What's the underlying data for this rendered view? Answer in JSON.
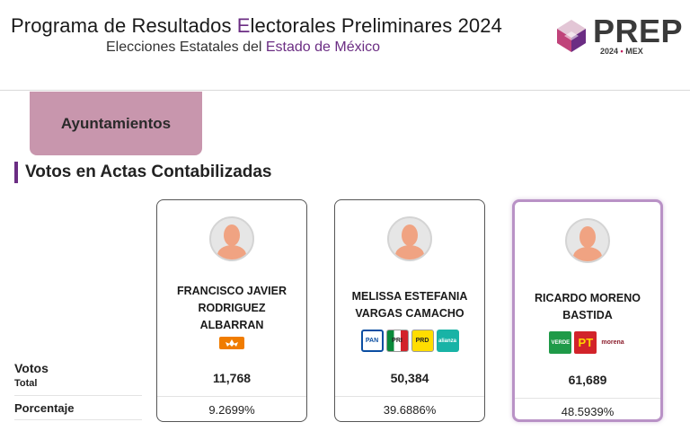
{
  "header": {
    "title_parts": [
      "Programa de Resultados ",
      "E",
      "lectorales Preliminares 2024"
    ],
    "subtitle_parts": [
      "Elecciones Estatales del ",
      "Estado de México"
    ],
    "logo_word": "PREP",
    "logo_year": "2024",
    "logo_dot": "•",
    "logo_state": "MEX"
  },
  "tabs": {
    "active_label": "Ayuntamientos"
  },
  "section": {
    "title": "Votos en Actas Contabilizadas"
  },
  "rows": {
    "votos_label": "Votos",
    "total_label": "Total",
    "porcentaje_label": "Porcentaje"
  },
  "candidates": [
    {
      "name_lines": [
        "FRANCISCO JAVIER",
        "RODRIGUEZ",
        "ALBARRAN"
      ],
      "parties": [
        "Movimiento Ciudadano"
      ],
      "party_short": [
        "MC"
      ],
      "votes": "11,768",
      "percentage": "9.2699%"
    },
    {
      "name_lines": [
        "MELISSA ESTEFANIA",
        "VARGAS CAMACHO"
      ],
      "parties": [
        "PAN",
        "PRI",
        "PRD",
        "alianza"
      ],
      "party_short": [
        "PAN",
        "PRI",
        "PRD",
        "alianza"
      ],
      "votes": "50,384",
      "percentage": "39.6886%"
    },
    {
      "name_lines": [
        "RICARDO MORENO",
        "BASTIDA"
      ],
      "parties": [
        "VERDE",
        "PT",
        "morena"
      ],
      "party_short": [
        "VERDE",
        "PT",
        "morena"
      ],
      "votes": "61,689",
      "percentage": "48.5939%",
      "leading": true
    }
  ],
  "colors": {
    "accent": "#6b2d83",
    "tab_bg": "#c896ad",
    "winner_border": "#b992c6",
    "avatar_skin": "#f0a382"
  }
}
